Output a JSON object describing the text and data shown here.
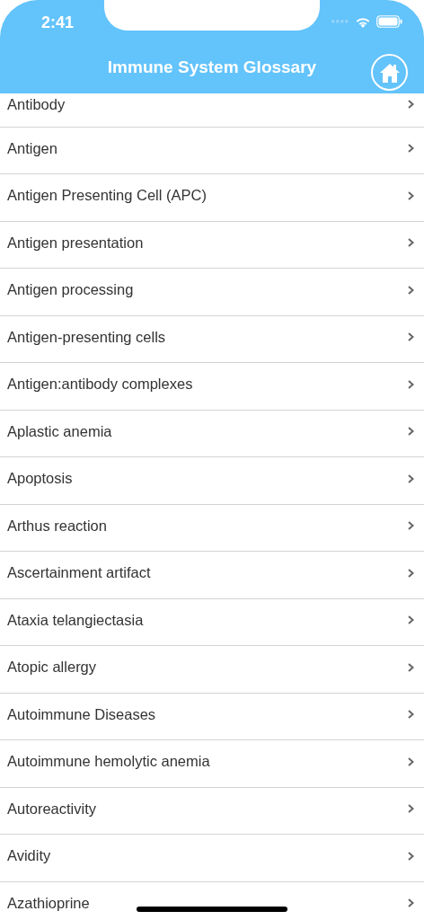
{
  "status_bar": {
    "time": "2:41"
  },
  "nav_bar": {
    "title": "Immune System Glossary"
  },
  "terms": [
    "Antibody",
    "Antigen",
    "Antigen Presenting Cell (APC)",
    "Antigen presentation",
    "Antigen processing",
    "Antigen-presenting cells",
    "Antigen:antibody complexes",
    "Aplastic anemia",
    "Apoptosis",
    "Arthus reaction",
    "Ascertainment artifact",
    "Ataxia telangiectasia",
    "Atopic allergy",
    "Autoimmune Diseases",
    "Autoimmune hemolytic anemia",
    "Autoreactivity",
    "Avidity",
    "Azathioprine"
  ]
}
